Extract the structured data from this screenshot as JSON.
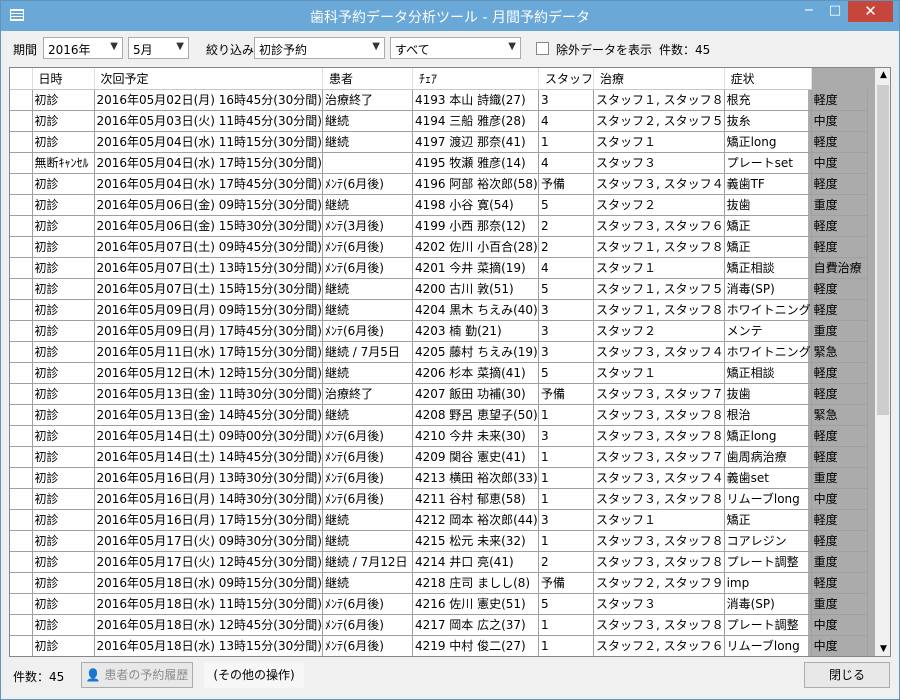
{
  "window": {
    "title": "歯科予約データ分析ツール - 月間予約データ"
  },
  "titlebar": {
    "minimize": "−",
    "maximize": "□",
    "close": "✕"
  },
  "filters": {
    "period_label": "期間",
    "year": "2016年",
    "month": "5月",
    "narrow_label": "絞り込み",
    "type": "初診予約",
    "scope": "すべて",
    "exclude_label": "除外データを表示",
    "count": "件数：45"
  },
  "table": {
    "columns": [
      "",
      "日時",
      "次回予定",
      "患者",
      "ﾁｪｱ",
      "スタッフ",
      "治療",
      "症状"
    ],
    "rows": [
      [
        "初診",
        "2016年05月02日(月) 16時45分(30分間)",
        "治療終了",
        "4193 本山 詩織(27)",
        "3",
        "スタッフ１, スタッフ８",
        "根充",
        "軽度"
      ],
      [
        "初診",
        "2016年05月03日(火) 11時45分(30分間)",
        "継続",
        "4194 三船 雅彦(28)",
        "4",
        "スタッフ２, スタッフ５",
        "抜糸",
        "中度"
      ],
      [
        "初診",
        "2016年05月04日(水) 11時15分(30分間)",
        "継続",
        "4197 渡辺 那奈(41)",
        "1",
        "スタッフ１",
        "矯正long",
        "軽度"
      ],
      [
        "無断ｷｬﾝｾﾙ",
        "2016年05月04日(水) 17時15分(30分間)",
        "",
        "4195 牧瀬 雅彦(14)",
        "4",
        "スタッフ３",
        "プレートset",
        "中度"
      ],
      [
        "初診",
        "2016年05月04日(水) 17時45分(30分間)",
        "ﾒﾝﾃ(6月後)",
        "4196 阿部 裕次郎(58)",
        "予備",
        "スタッフ３, スタッフ４",
        "義歯TF",
        "軽度"
      ],
      [
        "初診",
        "2016年05月06日(金) 09時15分(30分間)",
        "継続",
        "4198 小谷 寛(54)",
        "5",
        "スタッフ２",
        "抜歯",
        "重度"
      ],
      [
        "初診",
        "2016年05月06日(金) 15時30分(30分間)",
        "ﾒﾝﾃ(3月後)",
        "4199 小西 那奈(12)",
        "2",
        "スタッフ３, スタッフ６",
        "矯正",
        "軽度"
      ],
      [
        "初診",
        "2016年05月07日(土) 09時45分(30分間)",
        "ﾒﾝﾃ(6月後)",
        "4202 佐川 小百合(28)",
        "2",
        "スタッフ１, スタッフ８",
        "矯正",
        "軽度"
      ],
      [
        "初診",
        "2016年05月07日(土) 13時15分(30分間)",
        "ﾒﾝﾃ(6月後)",
        "4201 今井 菜摘(19)",
        "4",
        "スタッフ１",
        "矯正相談",
        "自費治療"
      ],
      [
        "初診",
        "2016年05月07日(土) 15時15分(30分間)",
        "継続",
        "4200 古川 敦(51)",
        "5",
        "スタッフ１, スタッフ５",
        "消毒(SP)",
        "軽度"
      ],
      [
        "初診",
        "2016年05月09日(月) 09時15分(30分間)",
        "継続",
        "4204 黒木 ちえみ(40)",
        "3",
        "スタッフ１, スタッフ８",
        "ホワイトニング",
        "軽度"
      ],
      [
        "初診",
        "2016年05月09日(月) 17時45分(30分間)",
        "ﾒﾝﾃ(6月後)",
        "4203 楠 勤(21)",
        "3",
        "スタッフ２",
        "メンテ",
        "重度"
      ],
      [
        "初診",
        "2016年05月11日(水) 17時15分(30分間)",
        "継続 / 7月5日",
        "4205 藤村 ちえみ(19)",
        "3",
        "スタッフ３, スタッフ４",
        "ホワイトニング",
        "緊急"
      ],
      [
        "初診",
        "2016年05月12日(木) 12時15分(30分間)",
        "継続",
        "4206 杉本 菜摘(41)",
        "5",
        "スタッフ１",
        "矯正相談",
        "軽度"
      ],
      [
        "初診",
        "2016年05月13日(金) 11時30分(30分間)",
        "治療終了",
        "4207 飯田 功補(30)",
        "予備",
        "スタッフ３, スタッフ７",
        "抜歯",
        "軽度"
      ],
      [
        "初診",
        "2016年05月13日(金) 14時45分(30分間)",
        "継続",
        "4208 野呂 恵望子(50)",
        "1",
        "スタッフ３, スタッフ８",
        "根治",
        "緊急"
      ],
      [
        "初診",
        "2016年05月14日(土) 09時00分(30分間)",
        "ﾒﾝﾃ(6月後)",
        "4210 今井 未来(30)",
        "3",
        "スタッフ３, スタッフ８",
        "矯正long",
        "軽度"
      ],
      [
        "初診",
        "2016年05月14日(土) 14時45分(30分間)",
        "ﾒﾝﾃ(6月後)",
        "4209 関谷 憲史(41)",
        "1",
        "スタッフ３, スタッフ７",
        "歯周病治療",
        "軽度"
      ],
      [
        "初診",
        "2016年05月16日(月) 13時30分(30分間)",
        "ﾒﾝﾃ(6月後)",
        "4213 横田 裕次郎(33)",
        "1",
        "スタッフ３, スタッフ４",
        "義歯set",
        "重度"
      ],
      [
        "初診",
        "2016年05月16日(月) 14時30分(30分間)",
        "ﾒﾝﾃ(6月後)",
        "4211 谷村 郁恵(58)",
        "1",
        "スタッフ３, スタッフ８",
        "リムーブlong",
        "中度"
      ],
      [
        "初診",
        "2016年05月16日(月) 17時15分(30分間)",
        "継続",
        "4212 岡本 裕次郎(44)",
        "3",
        "スタッフ１",
        "矯正",
        "軽度"
      ],
      [
        "初診",
        "2016年05月17日(火) 09時30分(30分間)",
        "継続",
        "4215 松元 未来(32)",
        "1",
        "スタッフ３, スタッフ８",
        "コアレジン",
        "軽度"
      ],
      [
        "初診",
        "2016年05月17日(火) 12時45分(30分間)",
        "継続 / 7月12日",
        "4214 井口 亮(41)",
        "2",
        "スタッフ３, スタッフ８",
        "プレート調整",
        "重度"
      ],
      [
        "初診",
        "2016年05月18日(水) 09時15分(30分間)",
        "継続",
        "4218 庄司 ましし(8)",
        "予備",
        "スタッフ２, スタッフ９",
        "imp",
        "軽度"
      ],
      [
        "初診",
        "2016年05月18日(水) 11時15分(30分間)",
        "ﾒﾝﾃ(6月後)",
        "4216 佐川 憲史(51)",
        "5",
        "スタッフ３",
        "消毒(SP)",
        "重度"
      ],
      [
        "初診",
        "2016年05月18日(水) 12時45分(30分間)",
        "ﾒﾝﾃ(6月後)",
        "4217 岡本 広之(37)",
        "1",
        "スタッフ３, スタッフ８",
        "プレート調整",
        "中度"
      ],
      [
        "初診",
        "2016年05月18日(水) 13時15分(30分間)",
        "ﾒﾝﾃ(6月後)",
        "4219 中村 俊二(27)",
        "1",
        "スタッフ２, スタッフ６",
        "リムーブlong",
        "中度"
      ]
    ]
  },
  "footer": {
    "count": "件数：45",
    "history_button": "患者の予約履歴",
    "other_ops": "(その他の操作)",
    "close_button": "閉じる"
  }
}
